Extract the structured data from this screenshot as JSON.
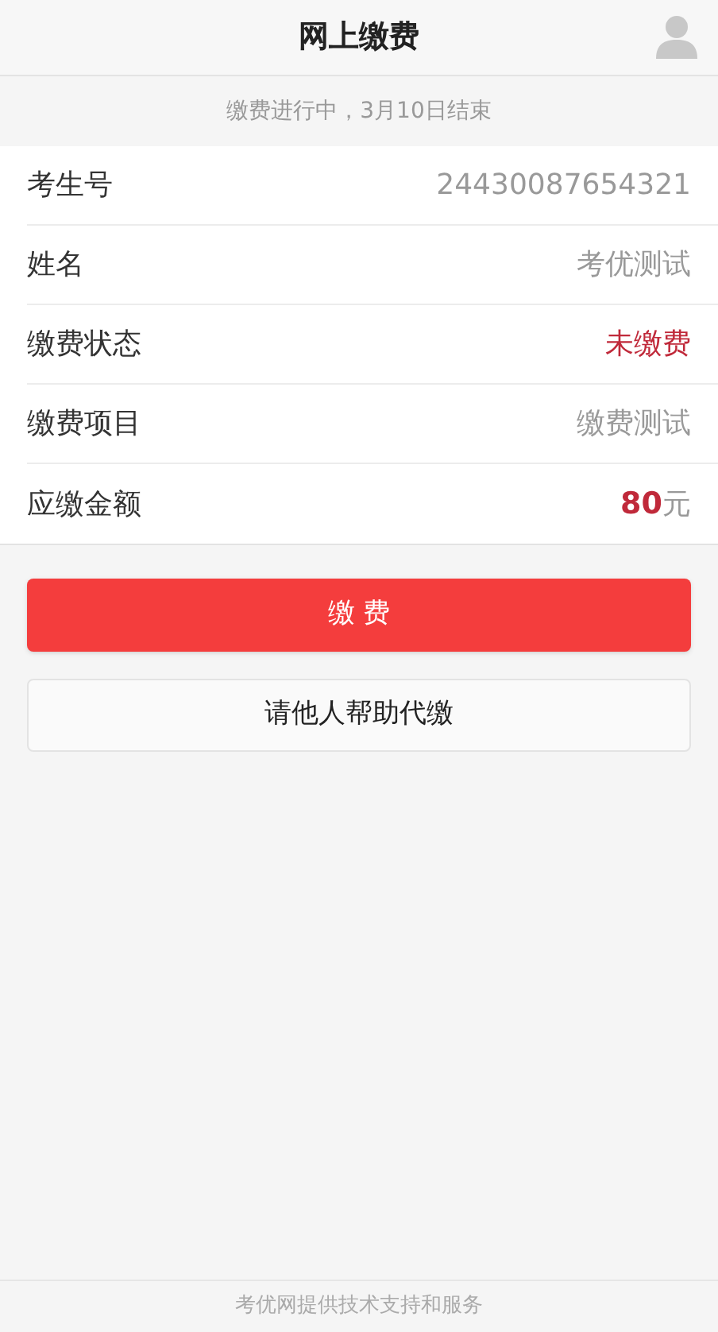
{
  "header": {
    "title": "网上缴费"
  },
  "notice": "缴费进行中，3月10日结束",
  "rows": [
    {
      "kind": "plain",
      "label": "考生号",
      "value": "24430087654321"
    },
    {
      "kind": "plain",
      "label": "姓名",
      "value": "考优测试"
    },
    {
      "kind": "status",
      "label": "缴费状态",
      "value": "未缴费"
    },
    {
      "kind": "plain",
      "label": "缴费项目",
      "value": "缴费测试"
    },
    {
      "kind": "amount",
      "label": "应缴金额",
      "value": "80",
      "unit": "元"
    }
  ],
  "buttons": [
    {
      "kind": "primary",
      "label": "缴 费"
    },
    {
      "kind": "secondary",
      "label": "请他人帮助代缴"
    }
  ],
  "footer": "考优网提供技术支持和服务"
}
